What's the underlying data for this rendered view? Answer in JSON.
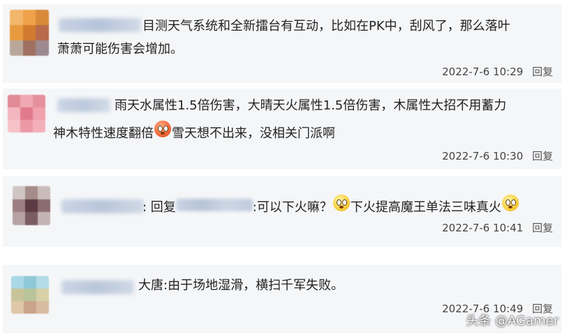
{
  "comments": [
    {
      "text_line1": "目测天气系统和全新擂台有互动，比如在PK中，刮风了，那么落叶",
      "text_line2": "萧萧可能伤害会增加。",
      "timestamp": "2022-7-6 10:29",
      "reply_label": "回复"
    },
    {
      "text_line1": "雨天水属性1.5倍伤害，大晴天火属性1.5倍伤害，木属性大招不用蓄力",
      "text_line2a": "神木特性速度翻倍",
      "text_line2b": "雪天想不出来，没相关门派啊",
      "timestamp": "2022-7-6 10:30",
      "reply_label": "回复"
    },
    {
      "reply_prefix": ":  回复",
      "text_a": ":可以下火嘛？",
      "text_b": "下火提高魔王单法三味真火",
      "timestamp": "2022-7-6 10:41",
      "reply_label": "回复"
    },
    {
      "text_line1": "大唐:由于场地湿滑，横扫千军失败。",
      "timestamp": "2022-7-6 10:49",
      "reply_label": "回复"
    }
  ],
  "watermark": "头条 @AGamer",
  "icons": {
    "emoji_1": "angry-face-emoji",
    "emoji_2": "surprised-face-emoji",
    "emoji_3": "surprised-face-emoji"
  }
}
